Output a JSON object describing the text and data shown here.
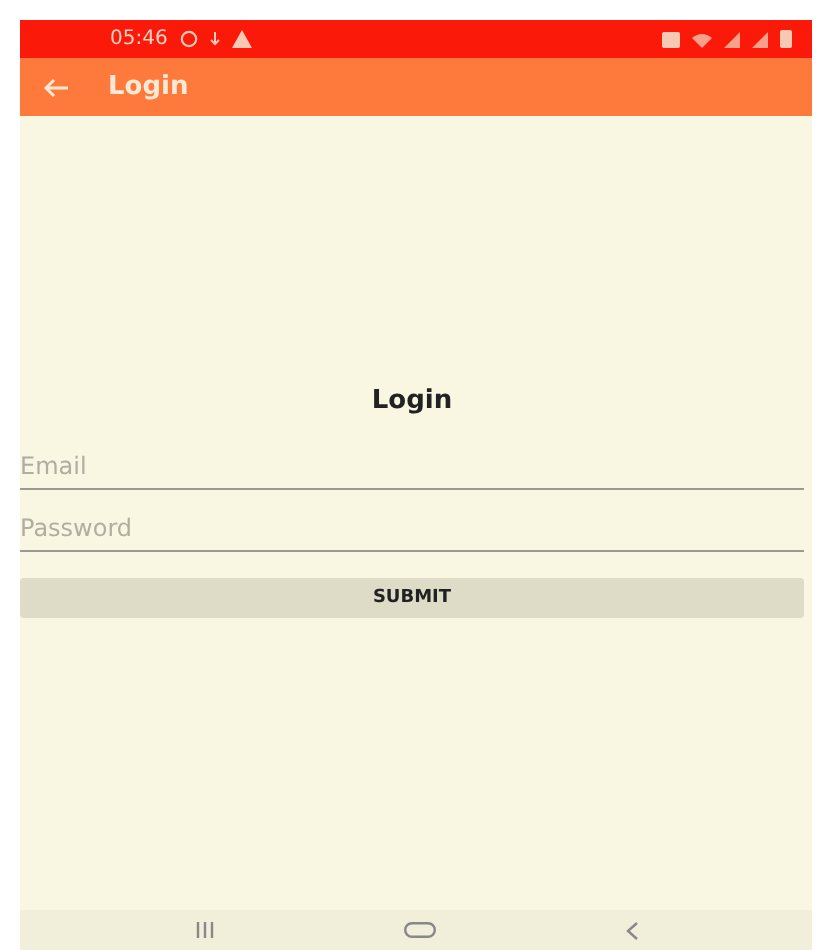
{
  "status_bar": {
    "time": "05:46"
  },
  "app_bar": {
    "title": "Login"
  },
  "form": {
    "heading": "Login",
    "fields": [
      {
        "placeholder": "Email"
      },
      {
        "placeholder": "Password"
      }
    ],
    "submit": "SUBMIT"
  }
}
